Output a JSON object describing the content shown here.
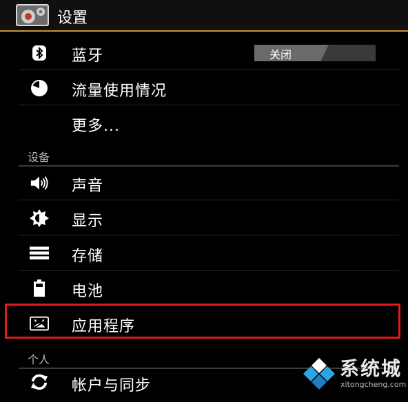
{
  "header": {
    "title": "设置",
    "icon": "settings-gear-icon"
  },
  "items": {
    "bluetooth": {
      "label": "蓝牙",
      "icon": "bluetooth-icon",
      "toggle": "关闭"
    },
    "data_usage": {
      "label": "流量使用情况",
      "icon": "data-usage-pie-icon"
    },
    "more": {
      "label": "更多..."
    }
  },
  "sections": {
    "device": "设备",
    "personal": "个人"
  },
  "device_items": {
    "sound": {
      "label": "声音",
      "icon": "speaker-icon"
    },
    "display": {
      "label": "显示",
      "icon": "brightness-icon"
    },
    "storage": {
      "label": "存储",
      "icon": "storage-icon"
    },
    "battery": {
      "label": "电池",
      "icon": "battery-icon"
    },
    "apps": {
      "label": "应用程序",
      "icon": "apps-icon"
    }
  },
  "personal_items": {
    "accounts": {
      "label": "帐户与同步",
      "icon": "sync-icon"
    }
  },
  "watermark": {
    "text": "系统城",
    "url": "xitongcheng.com"
  },
  "colors": {
    "accent": "#c8962e",
    "highlight": "#e31b1b"
  }
}
